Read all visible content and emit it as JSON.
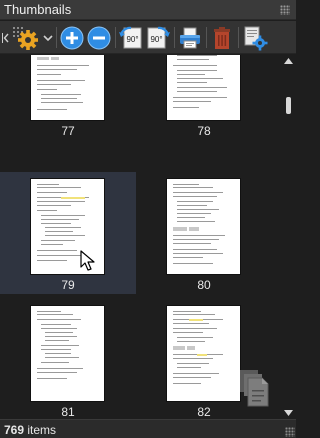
{
  "panel": {
    "title": "Thumbnails"
  },
  "toolbar": {
    "buttons": [
      {
        "name": "collapse-panel",
        "icon": "collapse-left-icon"
      },
      {
        "name": "thumbnail-settings",
        "icon": "gear-icon"
      },
      {
        "name": "settings-dropdown",
        "icon": "chevron-down-icon"
      },
      {
        "name": "zoom-in",
        "icon": "zoom-in-icon"
      },
      {
        "name": "zoom-out",
        "icon": "zoom-out-icon"
      },
      {
        "name": "rotate-left",
        "icon": "rotate-left-90-icon",
        "label": "90°"
      },
      {
        "name": "rotate-right",
        "icon": "rotate-right-90-icon",
        "label": "90°"
      },
      {
        "name": "print",
        "icon": "printer-icon"
      },
      {
        "name": "delete-pages",
        "icon": "trash-icon"
      },
      {
        "name": "page-properties",
        "icon": "page-settings-icon"
      }
    ]
  },
  "thumbnails": [
    {
      "page": "77",
      "selected": false
    },
    {
      "page": "78",
      "selected": false
    },
    {
      "page": "79",
      "selected": true
    },
    {
      "page": "80",
      "selected": false
    },
    {
      "page": "81",
      "selected": false
    },
    {
      "page": "82",
      "selected": false
    }
  ],
  "status": {
    "count": "769",
    "suffix": " items"
  },
  "colors": {
    "accent_blue": "#2f8de4",
    "selection": "#2f3440",
    "background": "#1e1e1e",
    "trash_red": "#b5452c"
  }
}
